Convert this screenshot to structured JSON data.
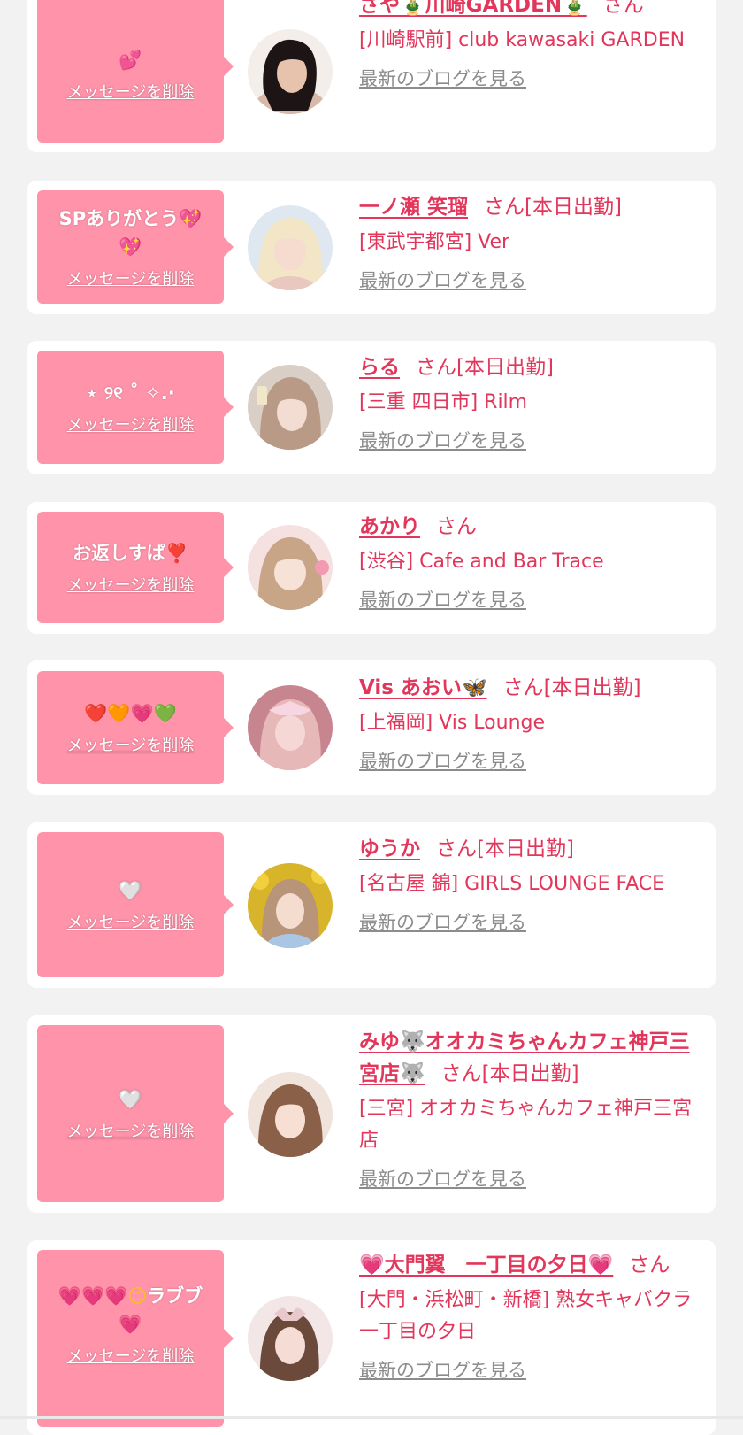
{
  "accent_color": "#e2365b",
  "bubble_color": "#ff93aa",
  "cards": [
    {
      "message": "💕",
      "delete_label": "メッセージを削除",
      "name": "さや🎍川崎GARDEN🎍",
      "san": "さん",
      "status": "",
      "shop": "[川崎駅前] club kawasaki GARDEN",
      "blog_label": "最新のブログを見る"
    },
    {
      "message": "SPありがとう💖💖",
      "delete_label": "メッセージを削除",
      "name": "一ノ瀬 笑瑠",
      "san": "さん",
      "status": "[本日出勤]",
      "shop": "[東武宇都宮] Ver",
      "blog_label": "最新のブログを見る"
    },
    {
      "message": "⋆ ୨୧ ˚ ✧.·",
      "delete_label": "メッセージを削除",
      "name": "らる",
      "san": "さん",
      "status": "[本日出勤]",
      "shop": "[三重 四日市] Rilm",
      "blog_label": "最新のブログを見る"
    },
    {
      "message": "お返しすぱ❣️",
      "delete_label": "メッセージを削除",
      "name": "あかり",
      "san": "さん",
      "status": "",
      "shop": "[渋谷] Cafe and Bar Trace",
      "blog_label": "最新のブログを見る"
    },
    {
      "message": "❤️🧡💗💚",
      "delete_label": "メッセージを削除",
      "name": "Vis あおい🦋",
      "san": "さん",
      "status": "[本日出勤]",
      "shop": "[上福岡] Vis Lounge",
      "blog_label": "最新のブログを見る"
    },
    {
      "message": "🤍",
      "delete_label": "メッセージを削除",
      "name": "ゆうか",
      "san": "さん",
      "status": "[本日出勤]",
      "shop": "[名古屋 錦] GIRLS LOUNGE FACE",
      "blog_label": "最新のブログを見る"
    },
    {
      "message": "🤍",
      "delete_label": "メッセージを削除",
      "name": "みゆ🐺オオカミちゃんカフェ神戸三宮店🐺",
      "san": "さん",
      "status": "[本日出勤]",
      "shop": "[三宮] オオカミちゃんカフェ神戸三宮店",
      "blog_label": "最新のブログを見る"
    },
    {
      "message": "💗💗💗😊ラブブ💗",
      "delete_label": "メッセージを削除",
      "name": "💗大門翼　一丁目の夕日💗",
      "san": "さん",
      "status": "",
      "shop": "[大門・浜松町・新橋] 熟女キャバクラ 一丁目の夕日",
      "blog_label": "最新のブログを見る"
    }
  ]
}
